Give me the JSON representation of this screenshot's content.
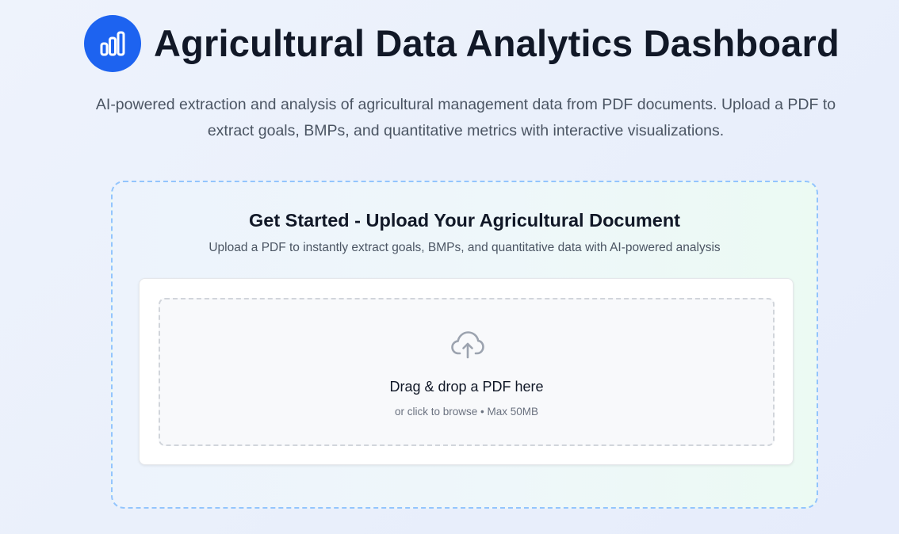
{
  "header": {
    "logo_icon": "bar-chart-icon",
    "title": "Agricultural Data Analytics Dashboard",
    "accent_color": "#1d63f0"
  },
  "intro": {
    "description": "AI-powered extraction and analysis of agricultural management data from PDF documents. Upload a PDF to extract goals, BMPs, and quantitative metrics with interactive visualizations."
  },
  "upload_section": {
    "title": "Get Started - Upload Your Agricultural Document",
    "description": "Upload a PDF to instantly extract goals, BMPs, and quantitative data with AI-powered analysis",
    "dropzone": {
      "icon": "cloud-upload-icon",
      "title": "Drag & drop a PDF here",
      "hint": "or click to browse • Max 50MB"
    }
  }
}
